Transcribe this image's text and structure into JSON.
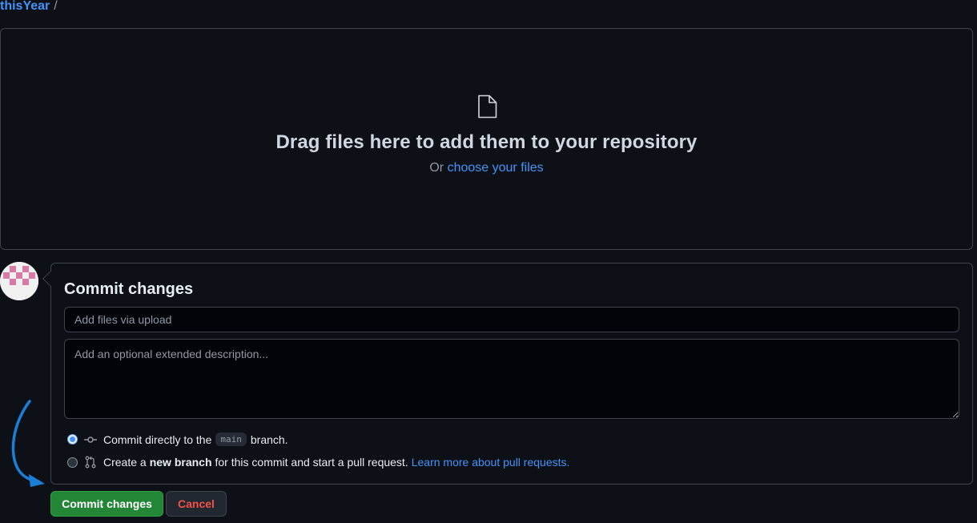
{
  "breadcrumb": {
    "repo": "thisYear",
    "separator": "/"
  },
  "dropzone": {
    "icon": "file-icon",
    "title": "Drag files here to add them to your repository",
    "or_text": "Or",
    "choose_link": "choose your files"
  },
  "avatar": {
    "icon": "identicon"
  },
  "commit": {
    "heading": "Commit changes",
    "summary_placeholder": "Add files via upload",
    "summary_value": "",
    "description_placeholder": "Add an optional extended description...",
    "description_value": "",
    "option_direct": {
      "selected": true,
      "icon": "git-commit-icon",
      "prefix": "Commit directly to the",
      "branch": "main",
      "suffix": "branch."
    },
    "option_new_branch": {
      "selected": false,
      "icon": "git-pull-request-icon",
      "prefix": "Create a",
      "bold": "new branch",
      "suffix": "for this commit and start a pull request.",
      "link": "Learn more about pull requests."
    }
  },
  "buttons": {
    "commit_label": "Commit changes",
    "cancel_label": "Cancel"
  },
  "colors": {
    "accent_link": "#4493f8",
    "commit_button": "#238636",
    "cancel_text": "#f85149",
    "annotation_arrow": "#1a7fd6"
  }
}
